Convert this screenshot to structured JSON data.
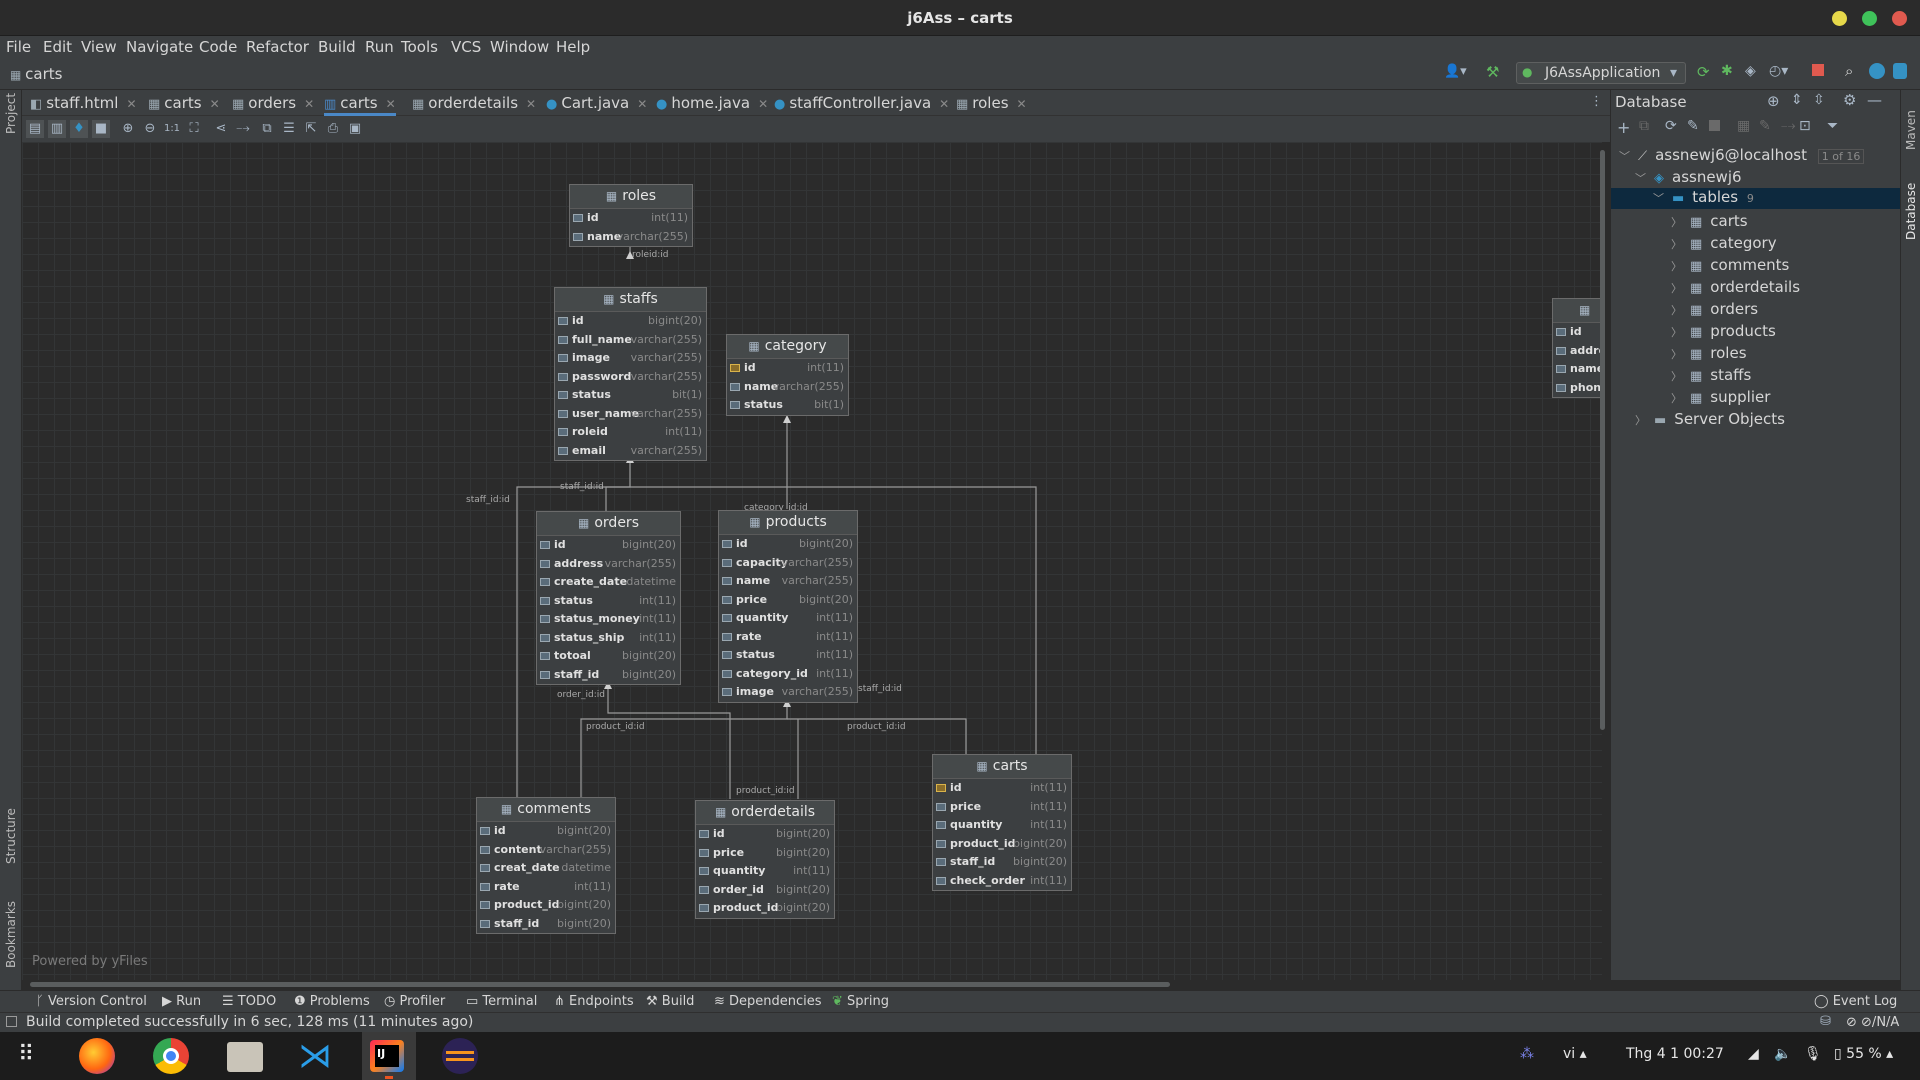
{
  "window": {
    "title": "j6Ass – carts"
  },
  "menu": [
    "File",
    "Edit",
    "View",
    "Navigate",
    "Code",
    "Refactor",
    "Build",
    "Run",
    "Tools",
    "VCS",
    "Window",
    "Help"
  ],
  "breadcrumb": "carts",
  "run_config": "J6AssApplication",
  "tabs": [
    {
      "label": "staff.html",
      "icon": "html-file-icon"
    },
    {
      "label": "carts",
      "icon": "table-icon"
    },
    {
      "label": "orders",
      "icon": "table-icon"
    },
    {
      "label": "carts",
      "icon": "diagram-icon",
      "active": true
    },
    {
      "label": "orderdetails",
      "icon": "table-icon"
    },
    {
      "label": "Cart.java",
      "icon": "java-class-icon"
    },
    {
      "label": "home.java",
      "icon": "java-class-icon"
    },
    {
      "label": "staffController.java",
      "icon": "java-class-icon"
    },
    {
      "label": "roles",
      "icon": "table-icon"
    }
  ],
  "left_stripe": {
    "project": "Project",
    "structure": "Structure",
    "bookmarks": "Bookmarks"
  },
  "right_stripe": {
    "maven": "Maven",
    "database": "Database"
  },
  "diagram": {
    "powered_by": "Powered by yFiles",
    "tables": {
      "roles": {
        "name": "roles",
        "columns": [
          [
            "id",
            "int(11)"
          ],
          [
            "name",
            "varchar(255)"
          ]
        ]
      },
      "staffs": {
        "name": "staffs",
        "columns": [
          [
            "id",
            "bigint(20)"
          ],
          [
            "full_name",
            "varchar(255)"
          ],
          [
            "image",
            "varchar(255)"
          ],
          [
            "password",
            "varchar(255)"
          ],
          [
            "status",
            "bit(1)"
          ],
          [
            "user_name",
            "varchar(255)"
          ],
          [
            "roleid",
            "int(11)"
          ],
          [
            "email",
            "varchar(255)"
          ]
        ]
      },
      "category": {
        "name": "category",
        "columns": [
          [
            "id",
            "int(11)"
          ],
          [
            "name",
            "varchar(255)"
          ],
          [
            "status",
            "bit(1)"
          ]
        ]
      },
      "orders": {
        "name": "orders",
        "columns": [
          [
            "id",
            "bigint(20)"
          ],
          [
            "address",
            "varchar(255)"
          ],
          [
            "create_date",
            "datetime"
          ],
          [
            "status",
            "int(11)"
          ],
          [
            "status_money",
            "int(11)"
          ],
          [
            "status_ship",
            "int(11)"
          ],
          [
            "totoal",
            "bigint(20)"
          ],
          [
            "staff_id",
            "bigint(20)"
          ]
        ]
      },
      "products": {
        "name": "products",
        "columns": [
          [
            "id",
            "bigint(20)"
          ],
          [
            "capacity",
            "varchar(255)"
          ],
          [
            "name",
            "varchar(255)"
          ],
          [
            "price",
            "bigint(20)"
          ],
          [
            "quantity",
            "int(11)"
          ],
          [
            "rate",
            "int(11)"
          ],
          [
            "status",
            "int(11)"
          ],
          [
            "category_id",
            "int(11)"
          ],
          [
            "image",
            "varchar(255)"
          ]
        ]
      },
      "comments": {
        "name": "comments",
        "columns": [
          [
            "id",
            "bigint(20)"
          ],
          [
            "content",
            "varchar(255)"
          ],
          [
            "creat_date",
            "datetime"
          ],
          [
            "rate",
            "int(11)"
          ],
          [
            "product_id",
            "bigint(20)"
          ],
          [
            "staff_id",
            "bigint(20)"
          ]
        ]
      },
      "orderdetails": {
        "name": "orderdetails",
        "columns": [
          [
            "id",
            "bigint(20)"
          ],
          [
            "price",
            "bigint(20)"
          ],
          [
            "quantity",
            "int(11)"
          ],
          [
            "order_id",
            "bigint(20)"
          ],
          [
            "product_id",
            "bigint(20)"
          ]
        ]
      },
      "carts": {
        "name": "carts",
        "columns": [
          [
            "id",
            "int(11)"
          ],
          [
            "price",
            "int(11)"
          ],
          [
            "quantity",
            "int(11)"
          ],
          [
            "product_id",
            "bigint(20)"
          ],
          [
            "staff_id",
            "bigint(20)"
          ],
          [
            "check_order",
            "int(11)"
          ]
        ]
      },
      "supplier_partial": {
        "columns": [
          "id",
          "addre",
          "name",
          "phon"
        ]
      }
    },
    "edge_labels": {
      "roleid": "roleid:id",
      "staff_orders": "staff_id:id",
      "staff_left": "staff_id:id",
      "category": "category_id:id",
      "order": "order_id:id",
      "product_left": "product_id:id",
      "product_right": "product_id:id",
      "product_od": "product_id:id",
      "staff_carts": "staff_id:id"
    }
  },
  "database_panel": {
    "title": "Database",
    "connection": "assnewj6@localhost",
    "connection_badge": "1 of 16",
    "schema": "assnewj6",
    "tables_label": "tables",
    "tables_count": "9",
    "tables": [
      "carts",
      "category",
      "comments",
      "orderdetails",
      "orders",
      "products",
      "roles",
      "staffs",
      "supplier"
    ],
    "server_objects": "Server Objects"
  },
  "bottom_tools": [
    "Version Control",
    "Run",
    "TODO",
    "Problems",
    "Profiler",
    "Terminal",
    "Endpoints",
    "Build",
    "Dependencies",
    "Spring"
  ],
  "event_log": "Event Log",
  "status": {
    "message": "Build completed successfully in 6 sec, 128 ms (11 minutes ago)",
    "right": "N/A"
  },
  "taskbar": {
    "lang": "vi",
    "datetime": "Thg 4 1  00:27",
    "battery": "55 %"
  },
  "colors": {
    "accent": "#4a88c7",
    "selection": "#0d293e",
    "close": "#e05a4f",
    "minimize": "#e6d84a",
    "maximize": "#3fc25a"
  }
}
